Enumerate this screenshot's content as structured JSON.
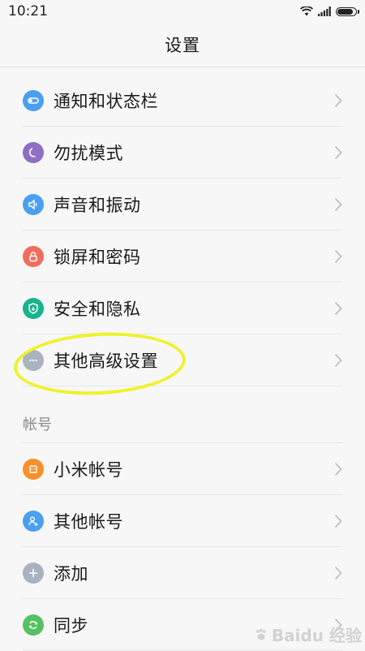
{
  "status_bar": {
    "time": "10:21",
    "battery_level": 0.95
  },
  "header": {
    "title": "设置"
  },
  "settings_items": [
    {
      "label": "通知和状态栏",
      "icon": "toggle-icon",
      "color": "#4a9ff0"
    },
    {
      "label": "勿扰模式",
      "icon": "moon-icon",
      "color": "#8e6fc5"
    },
    {
      "label": "声音和振动",
      "icon": "speaker-icon",
      "color": "#4a9ff0"
    },
    {
      "label": "锁屏和密码",
      "icon": "lock-icon",
      "color": "#f06c5c"
    },
    {
      "label": "安全和隐私",
      "icon": "shield-icon",
      "color": "#18b48c"
    },
    {
      "label": "其他高级设置",
      "icon": "more-icon",
      "color": "#a9b3bf"
    }
  ],
  "accounts_section": {
    "header": "帐号",
    "items": [
      {
        "label": "小米帐号",
        "icon": "mi-icon",
        "color": "#f5902b"
      },
      {
        "label": "其他帐号",
        "icon": "user-add-icon",
        "color": "#4a9ff0"
      },
      {
        "label": "添加",
        "icon": "plus-icon",
        "color": "#a9b3bf"
      },
      {
        "label": "同步",
        "icon": "sync-icon",
        "color": "#55c162"
      }
    ]
  },
  "annotation": {
    "color": "#eef22a"
  },
  "watermark": {
    "text": "Baidu 经验"
  }
}
